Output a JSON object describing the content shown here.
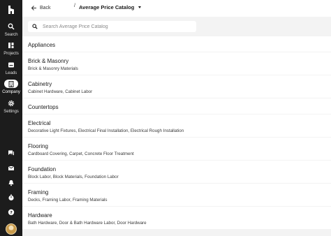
{
  "sidebar": {
    "logo": "houzz-logo-icon",
    "items": [
      {
        "label": "Search",
        "icon": "search-icon"
      },
      {
        "label": "Projects",
        "icon": "projects-icon"
      },
      {
        "label": "Leads",
        "icon": "leads-icon"
      },
      {
        "label": "Company",
        "icon": "company-icon",
        "active": true
      },
      {
        "label": "Settings",
        "icon": "gear-icon"
      }
    ],
    "bottom_icons": [
      "chat-icon",
      "mail-icon",
      "bell-icon",
      "timer-icon",
      "help-icon"
    ]
  },
  "header": {
    "back_label": "Back",
    "separator": "/",
    "title": "Average Price Catalog"
  },
  "search": {
    "placeholder": "Search Average Price Catalog"
  },
  "categories": [
    {
      "name": "Appliances",
      "sub": ""
    },
    {
      "name": "Brick & Masonry",
      "sub": "Brick & Masonry Materials"
    },
    {
      "name": "Cabinetry",
      "sub": "Cabinet Hardware, Cabinet Labor"
    },
    {
      "name": "Countertops",
      "sub": ""
    },
    {
      "name": "Electrical",
      "sub": "Decorative Light Fixtures, Electrical Final Installation, Electrical Rough Installation"
    },
    {
      "name": "Flooring",
      "sub": "Cardboard Covering, Carpet, Concrete Floor Treatment"
    },
    {
      "name": "Foundation",
      "sub": "Block Labor, Block Materials, Foundation Labor"
    },
    {
      "name": "Framing",
      "sub": "Decks, Framing Labor, Framing Materials"
    },
    {
      "name": "Hardware",
      "sub": "Bath Hardware, Door & Bath Hardware Labor, Door Hardware"
    }
  ],
  "colors": {
    "sidebar_bg": "#1c1c1c",
    "content_bg": "#f3f3f3",
    "row_bg": "#ffffff"
  }
}
